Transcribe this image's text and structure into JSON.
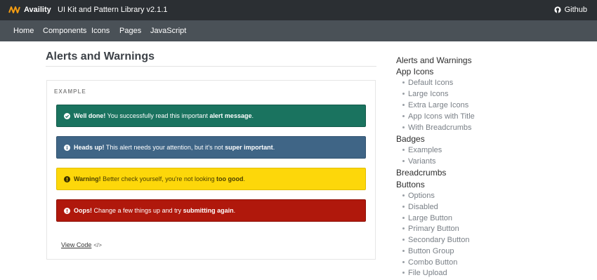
{
  "topbar": {
    "brand": "Availity",
    "library_title": "UI Kit and Pattern Library v2.1.1",
    "github_label": "Github"
  },
  "nav": [
    "Home",
    "Components",
    "Icons",
    "Pages",
    "JavaScript"
  ],
  "main": {
    "title": "Alerts and Warnings",
    "example_label": "EXAMPLE",
    "alerts": {
      "success": {
        "strong": "Well done!",
        "text": " You successfully read this important ",
        "emph": "alert message",
        "end": "."
      },
      "info": {
        "strong": "Heads up!",
        "text": " This alert needs your attention, but it's not ",
        "emph": "super important",
        "end": "."
      },
      "warning": {
        "strong": "Warning!",
        "text": " Better check yourself, you're not looking ",
        "emph": "too good",
        "end": "."
      },
      "danger": {
        "strong": "Oops!",
        "text": " Change a few things up and try ",
        "emph": "submitting again",
        "end": "."
      }
    },
    "view_code": "View Code",
    "code_icon": "</>"
  },
  "sidebar": {
    "items": [
      {
        "label": "Alerts and Warnings"
      },
      {
        "label": "App Icons"
      },
      {
        "label": "Default Icons"
      },
      {
        "label": "Large Icons"
      },
      {
        "label": "Extra Large Icons"
      },
      {
        "label": "App Icons with Title"
      },
      {
        "label": "With Breadcrumbs"
      },
      {
        "label": "Badges"
      },
      {
        "label": "Examples"
      },
      {
        "label": "Variants"
      },
      {
        "label": "Breadcrumbs"
      },
      {
        "label": "Buttons"
      },
      {
        "label": "Options"
      },
      {
        "label": "Disabled"
      },
      {
        "label": "Large Button"
      },
      {
        "label": "Primary Button"
      },
      {
        "label": "Secondary Button"
      },
      {
        "label": "Button Group"
      },
      {
        "label": "Combo Button"
      },
      {
        "label": "File Upload"
      }
    ]
  },
  "colors": {
    "topbar": "#2b2f33",
    "navbar": "#4a5157",
    "success": "#1a735f",
    "info": "#3f6586",
    "warning": "#fdd70a",
    "danger": "#b0180c"
  },
  "icons": {
    "brand": "availity-logo-icon",
    "github": "github-icon",
    "success": "check-circle-icon",
    "info": "info-circle-icon",
    "warning": "exclamation-circle-icon",
    "danger": "alert-circle-icon"
  }
}
